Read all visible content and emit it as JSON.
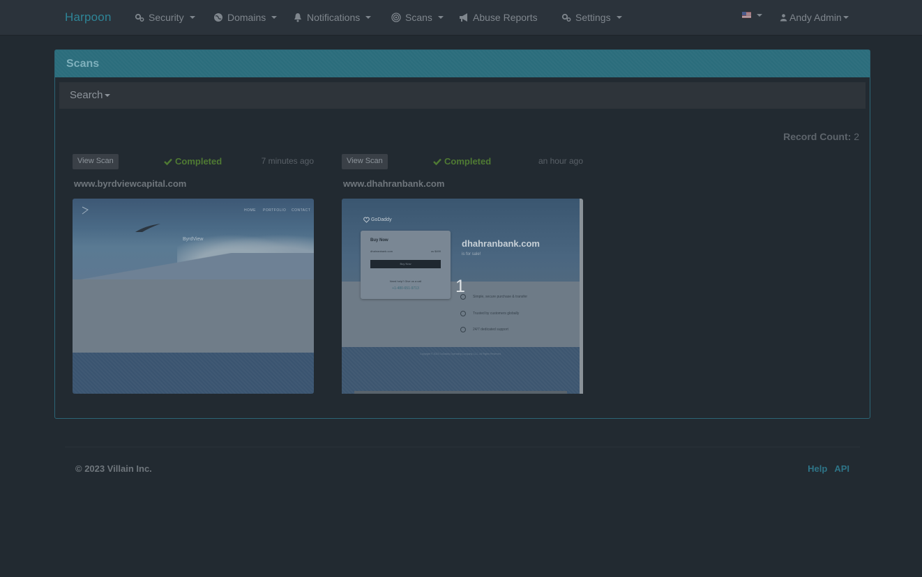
{
  "navbar": {
    "brand": "Harpoon",
    "items": [
      {
        "label": "Security",
        "icon": "gears-icon"
      },
      {
        "label": "Domains",
        "icon": "globe-icon"
      },
      {
        "label": "Notifications",
        "icon": "bell-icon"
      },
      {
        "label": "Scans",
        "icon": "target-icon"
      },
      {
        "label": "Abuse Reports",
        "icon": "bullhorn-icon"
      },
      {
        "label": "Settings",
        "icon": "gears-icon"
      }
    ],
    "language_icon": "us-flag-icon",
    "user": "Andy Admin"
  },
  "panel": {
    "title": "Scans",
    "search_label": "Search",
    "record_count_label": "Record Count:",
    "record_count_value": "2"
  },
  "scans": [
    {
      "button": "View Scan",
      "status": "Completed",
      "time": "7 minutes ago",
      "domain": "www.byrdviewcapital.com",
      "preview": {
        "nav": [
          "HOME",
          "PORTFOLIO",
          "CONTACT"
        ],
        "heading": "ByrdView"
      }
    },
    {
      "button": "View Scan",
      "status": "Completed",
      "time": "an hour ago",
      "domain": "www.dhahranbank.com",
      "preview": {
        "logo": "GoDaddy",
        "box_title": "Buy Now",
        "box_domain": "dhahranbank.com",
        "box_price": "us $499",
        "box_button": "Buy Now",
        "box_help": "Need help? Give us a call",
        "box_phone": "+1-480-651-9713",
        "big_domain": "dhahranbank.com",
        "for_sale": "is for sale!",
        "features": [
          "Simple, secure purchase & transfer",
          "Trusted by customers globally",
          "24/7 dedicated support"
        ],
        "copyright": "Copyright © 2023 GoDaddy Operating Company, LLC. All Rights Reserved.",
        "marker": "1"
      }
    }
  ],
  "footer": {
    "copyright": "© 2023 Villain Inc.",
    "links": [
      "Help",
      "API"
    ]
  },
  "colors": {
    "background": "#222a31",
    "navbar": "#2b333b",
    "panel_heading": "#2b6d7c",
    "brand": "#2e8597",
    "status_completed": "#4f7a33",
    "link": "#2e7487"
  }
}
